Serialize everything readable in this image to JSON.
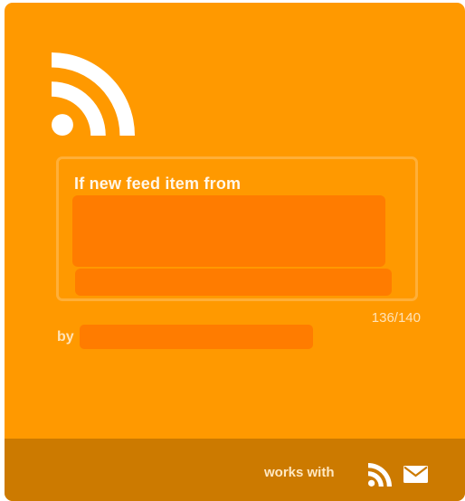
{
  "recipe": {
    "heading": "If new feed item from",
    "counter": "136/140",
    "by_label": "by"
  },
  "footer": {
    "works_with_label": "works with",
    "services": [
      "rss-icon",
      "email-icon"
    ]
  },
  "colors": {
    "card_background": "#ff9900",
    "footer_background": "#cc7a00",
    "redaction": "#ff7c00",
    "text_light": "#fff7ea"
  }
}
